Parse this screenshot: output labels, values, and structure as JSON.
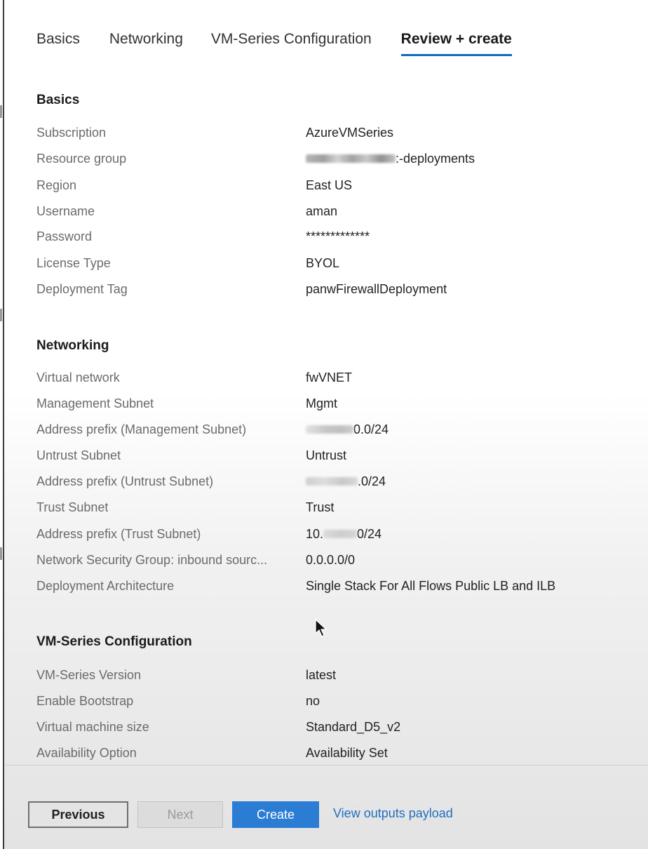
{
  "tabs": [
    {
      "label": "Basics"
    },
    {
      "label": "Networking"
    },
    {
      "label": "VM-Series Configuration"
    },
    {
      "label": "Review + create"
    }
  ],
  "active_tab": "Review + create",
  "accent_color": "#0f6cbd",
  "sections": {
    "basics": {
      "title": "Basics",
      "rows": [
        {
          "label": "Subscription",
          "value": "AzureVMSeries"
        },
        {
          "label": "Resource group",
          "value": ":-deployments"
        },
        {
          "label": "Region",
          "value": "East US"
        },
        {
          "label": "Username",
          "value": "aman"
        },
        {
          "label": "Password",
          "value": "*************"
        },
        {
          "label": "License Type",
          "value": "BYOL"
        },
        {
          "label": "Deployment Tag",
          "value": "panwFirewallDeployment"
        }
      ]
    },
    "networking": {
      "title": "Networking",
      "rows": [
        {
          "label": "Virtual network",
          "value": "fwVNET"
        },
        {
          "label": "Management Subnet",
          "value": "Mgmt"
        },
        {
          "label": "Address prefix (Management Subnet)",
          "value": "0.0/24"
        },
        {
          "label": "Untrust Subnet",
          "value": "Untrust"
        },
        {
          "label": "Address prefix (Untrust Subnet)",
          "value": ".0/24"
        },
        {
          "label": "Trust Subnet",
          "value": "Trust"
        },
        {
          "label": "Address prefix (Trust Subnet)",
          "value_prefix": "10.",
          "value": "0/24"
        },
        {
          "label": "Network Security Group: inbound sourc...",
          "value": "0.0.0.0/0"
        },
        {
          "label": "Deployment Architecture",
          "value": "Single Stack For All Flows Public LB and ILB"
        }
      ]
    },
    "vm_series": {
      "title": "VM-Series Configuration",
      "rows": [
        {
          "label": "VM-Series Version",
          "value": "latest"
        },
        {
          "label": "Enable Bootstrap",
          "value": "no"
        },
        {
          "label": "Virtual machine size",
          "value": "Standard_D5_v2"
        },
        {
          "label": "Availability Option",
          "value": "Availability Set"
        }
      ]
    }
  },
  "footer": {
    "previous_label": "Previous",
    "next_label": "Next",
    "create_label": "Create",
    "payload_link": "View outputs payload",
    "create_color": "#2b7cd3",
    "link_color": "#1f6fbf"
  }
}
